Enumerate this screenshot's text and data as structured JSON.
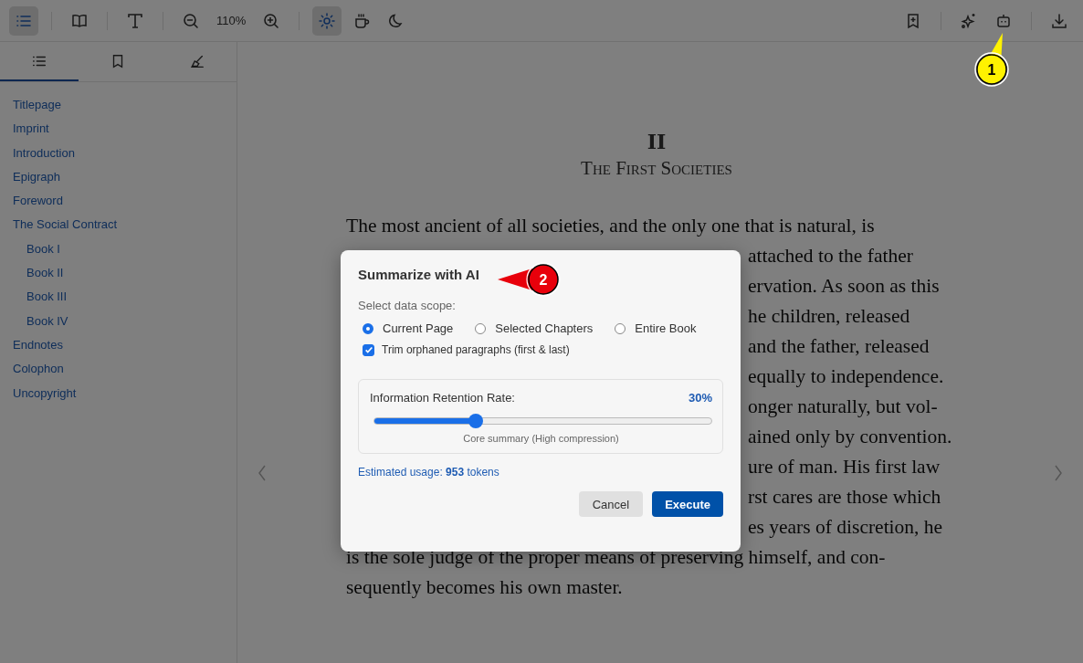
{
  "toolbar": {
    "left": [
      {
        "kind": "toggle-sidebar",
        "selected": true
      },
      {
        "kind": "book"
      },
      {
        "kind": "font"
      },
      {
        "kind": "zoom-out"
      },
      {
        "kind": "zoom-level",
        "label": "110%"
      },
      {
        "kind": "zoom-in"
      }
    ],
    "themes": [
      {
        "kind": "light",
        "selected": true
      },
      {
        "kind": "sepia",
        "selected": false
      },
      {
        "kind": "dark",
        "selected": false
      }
    ],
    "right": [
      {
        "kind": "add-bookmark"
      },
      {
        "kind": "sparkles"
      },
      {
        "kind": "robot"
      },
      {
        "kind": "download"
      }
    ]
  },
  "sidebar": {
    "tabs": [
      {
        "kind": "contents",
        "selected": true
      },
      {
        "kind": "bookmarks",
        "selected": false
      },
      {
        "kind": "highlights",
        "selected": false
      }
    ],
    "items": [
      {
        "label": "Titlepage"
      },
      {
        "label": "Imprint"
      },
      {
        "label": "Introduction"
      },
      {
        "label": "Epigraph"
      },
      {
        "label": "Foreword"
      },
      {
        "label": "The Social Contract",
        "children": [
          {
            "label": "Book I"
          },
          {
            "label": "Book II"
          },
          {
            "label": "Book III"
          },
          {
            "label": "Book IV"
          }
        ]
      },
      {
        "label": "Endnotes"
      },
      {
        "label": "Colophon"
      },
      {
        "label": "Uncopyright"
      }
    ]
  },
  "reader": {
    "chapter_number": "II",
    "chapter_title": "The First Societies",
    "lines": [
      {
        "text": "The most ancient of all societies, and the only one that is natural, is",
        "covered": false
      },
      {
        "text": "attached to the father",
        "covered": true
      },
      {
        "text": "ervation. As soon as this",
        "covered": true
      },
      {
        "text": "he children, released",
        "covered": true
      },
      {
        "text": "and the father, released",
        "covered": true
      },
      {
        "text": "equally to independence.",
        "covered": true
      },
      {
        "text": "onger naturally, but vol-",
        "covered": true
      },
      {
        "text": "ained only by convention.",
        "covered": true
      },
      {
        "text": "ure of man. His first law",
        "covered": true
      },
      {
        "text": "rst cares are those which",
        "covered": true
      },
      {
        "text": "es years of discretion, he",
        "covered": true
      },
      {
        "text": "is the sole judge of the proper means of preserving himself, and con-",
        "covered": false
      },
      {
        "text": "sequently becomes his own master.",
        "covered": false
      }
    ]
  },
  "dialog": {
    "title": "Summarize with AI",
    "scope_label": "Select data scope:",
    "scopes": [
      {
        "label": "Current Page",
        "selected": true
      },
      {
        "label": "Selected Chapters",
        "selected": false
      },
      {
        "label": "Entire Book",
        "selected": false
      }
    ],
    "trim": {
      "label": "Trim orphaned paragraphs (first & last)",
      "checked": true
    },
    "retention": {
      "label": "Information Retention Rate:",
      "value": "30%",
      "level": 0.3,
      "hint": "Core summary (High compression)"
    },
    "usage": "Estimated usage: **953** tokens",
    "buttons": [
      {
        "label": "Cancel",
        "kind": "secondary"
      },
      {
        "label": "Execute",
        "kind": "primary"
      }
    ]
  },
  "annotations": [
    {
      "label": "1",
      "kind": "yellow"
    },
    {
      "label": "2",
      "kind": "red"
    }
  ]
}
